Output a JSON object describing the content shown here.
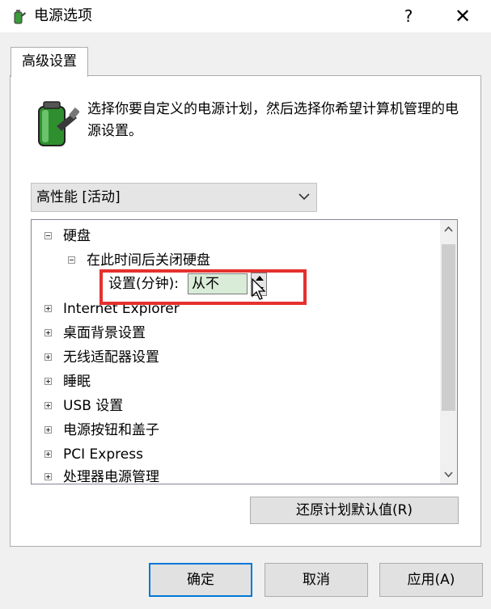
{
  "window": {
    "title": "电源选项",
    "help_glyph": "?",
    "close_glyph": "✕"
  },
  "tabs": [
    {
      "label": "高级设置",
      "active": true
    }
  ],
  "description": "选择你要自定义的电源计划，然后选择你希望计算机管理的电源设置。",
  "plan_select": {
    "value": "高性能 [活动]"
  },
  "tree": {
    "items": [
      {
        "label": "硬盘",
        "state": "expanded",
        "level": 0
      },
      {
        "label": "在此时间后关闭硬盘",
        "state": "expanded",
        "level": 1
      },
      {
        "label": "Internet Explorer",
        "state": "collapsed",
        "level": 0
      },
      {
        "label": "桌面背景设置",
        "state": "collapsed",
        "level": 0
      },
      {
        "label": "无线适配器设置",
        "state": "collapsed",
        "level": 0
      },
      {
        "label": "睡眠",
        "state": "collapsed",
        "level": 0
      },
      {
        "label": "USB 设置",
        "state": "collapsed",
        "level": 0
      },
      {
        "label": "电源按钮和盖子",
        "state": "collapsed",
        "level": 0
      },
      {
        "label": "PCI Express",
        "state": "collapsed",
        "level": 0
      },
      {
        "label": "处理器电源管理",
        "state": "collapsed",
        "level": 0
      }
    ],
    "setting": {
      "label": "设置(分钟):",
      "value": "从不"
    }
  },
  "buttons": {
    "restore": "还原计划默认值(R)",
    "ok": "确定",
    "cancel": "取消",
    "apply": "应用(A)"
  },
  "colors": {
    "highlight_box": "#e5312e",
    "setting_input_bg": "#d8ecd7",
    "default_button_border": "#0078d7"
  }
}
